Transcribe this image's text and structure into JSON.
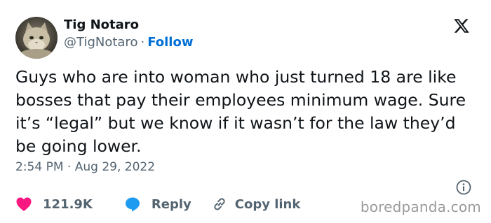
{
  "author": {
    "display_name": "Tig Notaro",
    "handle": "@TigNotaro",
    "separator": "·",
    "follow_label": "Follow"
  },
  "tweet": {
    "text": "Guys who are into woman who just turned 18 are like bosses that pay their employees minimum wage. Sure it’s “legal” but we know if it wasn’t for the law they’d be going lower.",
    "time": "2:54 PM",
    "separator": "·",
    "date": "Aug 29, 2022"
  },
  "actions": {
    "likes_count": "121.9K",
    "reply_label": "Reply",
    "copy_link_label": "Copy link"
  },
  "icons": {
    "platform_logo": "x-logo-icon",
    "info": "info-icon",
    "like": "heart-icon",
    "reply": "speech-bubble-icon",
    "copy": "link-icon"
  },
  "colors": {
    "like": "#f91880",
    "reply": "#1d9bf0",
    "follow": "#006fd6",
    "secondary_text": "#536471",
    "primary_text": "#0f1419"
  },
  "watermark": "boredpanda.com"
}
